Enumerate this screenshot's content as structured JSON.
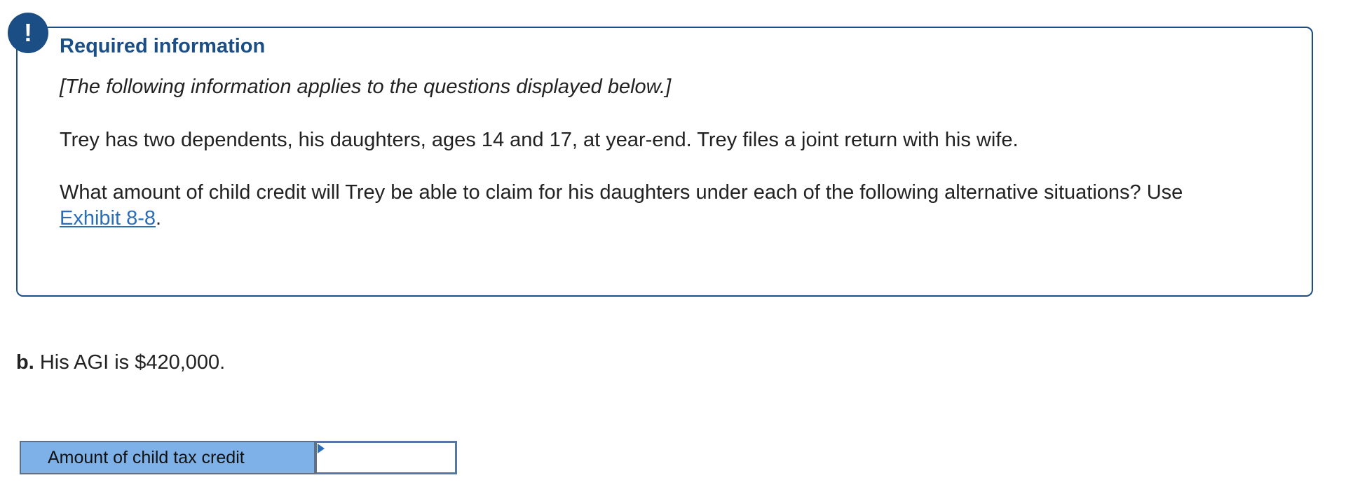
{
  "info_card": {
    "alert_symbol": "!",
    "title": "Required information",
    "note": "[The following information applies to the questions displayed below.]",
    "paragraph1": "Trey has two dependents, his daughters, ages 14 and 17, at year-end. Trey files a joint return with his wife.",
    "paragraph2_text": "What amount of child credit will Trey be able to claim for his daughters under each of the following alternative situations? Use ",
    "paragraph2_link": "Exhibit 8-8",
    "paragraph2_end": "."
  },
  "question": {
    "label": "b.",
    "text": " His AGI is $420,000."
  },
  "answer": {
    "label": "Amount of child tax credit",
    "value": ""
  }
}
